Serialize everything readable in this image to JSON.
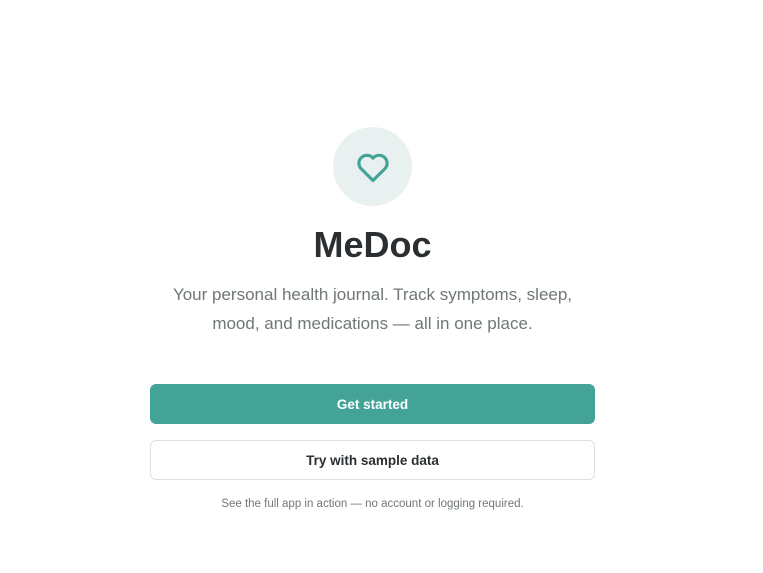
{
  "app": {
    "title": "MeDoc",
    "subtitle": "Your personal health journal. Track symptoms, sleep, mood, and medications — all in one place.",
    "logo_icon": "heart-icon",
    "accent_color": "#43a397"
  },
  "actions": {
    "get_started_label": "Get started",
    "sample_data_label": "Try with sample data",
    "sample_note": "See the full app in action — no account or logging required."
  }
}
